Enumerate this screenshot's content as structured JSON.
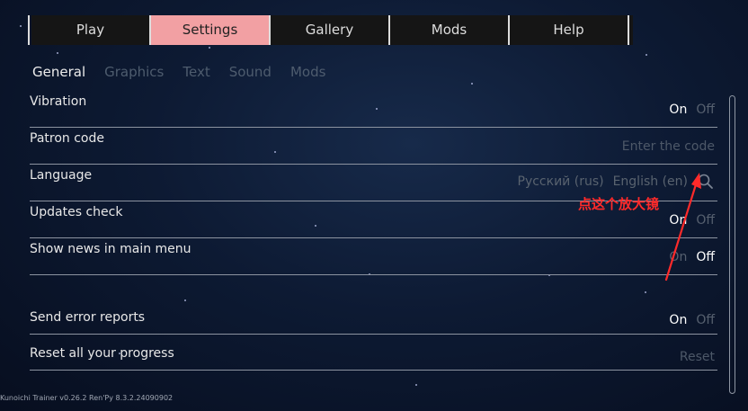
{
  "top_tabs": [
    {
      "label": "Play"
    },
    {
      "label": "Settings"
    },
    {
      "label": "Gallery"
    },
    {
      "label": "Mods"
    },
    {
      "label": "Help"
    }
  ],
  "sub_tabs": [
    {
      "label": "General"
    },
    {
      "label": "Graphics"
    },
    {
      "label": "Text"
    },
    {
      "label": "Sound"
    },
    {
      "label": "Mods"
    }
  ],
  "settings": {
    "vibration": {
      "label": "Vibration",
      "on": "On",
      "off": "Off"
    },
    "patron": {
      "label": "Patron code",
      "placeholder": "Enter the code"
    },
    "language": {
      "label": "Language",
      "russian": "Русский (rus)",
      "english": "English (en)"
    },
    "updates": {
      "label": "Updates check",
      "on": "On",
      "off": "Off"
    },
    "news": {
      "label": "Show news in main menu",
      "on": "On",
      "off": "Off"
    },
    "errors": {
      "label": "Send error reports",
      "on": "On",
      "off": "Off"
    },
    "reset": {
      "label": "Reset all your progress",
      "button": "Reset"
    }
  },
  "annotation": {
    "text": "点这个放大镜",
    "color": "#ff2a2a"
  },
  "footer": {
    "text": "Kunoichi Trainer v0.26.2   Ren'Py 8.3.2.24090902"
  },
  "colors": {
    "active_tab": "#f2a0a3",
    "tab_bar": "#151515",
    "background": "#0d1a33"
  }
}
